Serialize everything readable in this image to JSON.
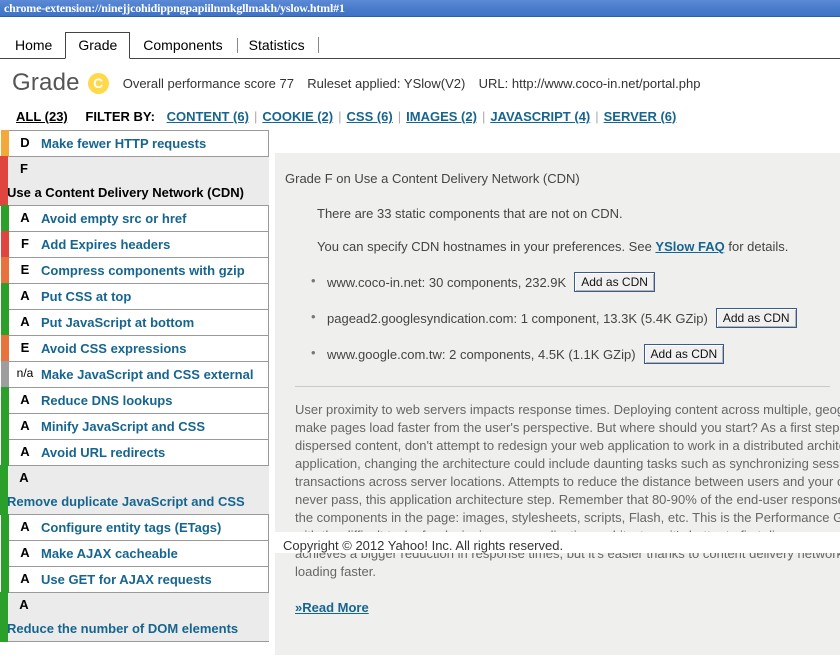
{
  "window": {
    "url": "chrome-extension://ninejjcohidippngpapiilnmkgllmakh/yslow.html#1"
  },
  "tabs": [
    {
      "label": "Home",
      "active": false
    },
    {
      "label": "Grade",
      "active": true
    },
    {
      "label": "Components",
      "active": false
    },
    {
      "label": "Statistics",
      "active": false
    }
  ],
  "header": {
    "grade_word": "Grade",
    "grade_letter": "C",
    "grade_color": "#ffd94a",
    "score_text": "Overall performance score 77",
    "ruleset_text": "Ruleset applied: YSlow(V2)",
    "url_text": "URL: http://www.coco-in.net/portal.php"
  },
  "filters": {
    "all_label": "ALL (23)",
    "filter_by_label": "FILTER BY:",
    "items": [
      {
        "label": "CONTENT (6)"
      },
      {
        "label": "COOKIE (2)"
      },
      {
        "label": "CSS (6)"
      },
      {
        "label": "IMAGES (2)"
      },
      {
        "label": "JAVASCRIPT (4)"
      },
      {
        "label": "SERVER (6)"
      }
    ]
  },
  "rules": [
    {
      "score": "D",
      "label": "Make fewer HTTP requests",
      "color": "#f2a83b",
      "selected": false,
      "wrapped": false
    },
    {
      "score": "F",
      "label": "Use a Content Delivery Network (CDN)",
      "color": "#e0443e",
      "selected": true,
      "wrapped": true
    },
    {
      "score": "A",
      "label": "Avoid empty src or href",
      "color": "#2aa02a",
      "selected": false,
      "wrapped": false
    },
    {
      "score": "F",
      "label": "Add Expires headers",
      "color": "#e0443e",
      "selected": false,
      "wrapped": false
    },
    {
      "score": "E",
      "label": "Compress components with gzip",
      "color": "#e8713c",
      "selected": false,
      "wrapped": false
    },
    {
      "score": "A",
      "label": "Put CSS at top",
      "color": "#2aa02a",
      "selected": false,
      "wrapped": false
    },
    {
      "score": "A",
      "label": "Put JavaScript at bottom",
      "color": "#2aa02a",
      "selected": false,
      "wrapped": false
    },
    {
      "score": "E",
      "label": "Avoid CSS expressions",
      "color": "#e8713c",
      "selected": false,
      "wrapped": false
    },
    {
      "score": "n/a",
      "label": "Make JavaScript and CSS external",
      "color": "#9e9e9e",
      "selected": false,
      "wrapped": false
    },
    {
      "score": "A",
      "label": "Reduce DNS lookups",
      "color": "#2aa02a",
      "selected": false,
      "wrapped": false
    },
    {
      "score": "A",
      "label": "Minify JavaScript and CSS",
      "color": "#2aa02a",
      "selected": false,
      "wrapped": false
    },
    {
      "score": "A",
      "label": "Avoid URL redirects",
      "color": "#2aa02a",
      "selected": false,
      "wrapped": false
    },
    {
      "score": "A",
      "label": "Remove duplicate JavaScript and CSS",
      "color": "#2aa02a",
      "selected": false,
      "wrapped": true
    },
    {
      "score": "A",
      "label": "Configure entity tags (ETags)",
      "color": "#2aa02a",
      "selected": false,
      "wrapped": false
    },
    {
      "score": "A",
      "label": "Make AJAX cacheable",
      "color": "#2aa02a",
      "selected": false,
      "wrapped": false
    },
    {
      "score": "A",
      "label": "Use GET for AJAX requests",
      "color": "#2aa02a",
      "selected": false,
      "wrapped": false
    },
    {
      "score": "A",
      "label": "Reduce the number of DOM elements",
      "color": "#2aa02a",
      "selected": false,
      "wrapped": true
    }
  ],
  "detail": {
    "title": "Grade F on Use a Content Delivery Network (CDN)",
    "summary": "There are 33 static components that are not on CDN.",
    "hint_prefix": "You can specify CDN hostnames in your preferences. See ",
    "hint_link": "YSlow FAQ",
    "hint_suffix": " for details.",
    "hosts": [
      {
        "text": "www.coco-in.net: 30 components, 232.9K",
        "button": "Add as CDN"
      },
      {
        "text": "pagead2.googlesyndication.com: 1 component, 13.3K (5.4K GZip)",
        "button": "Add as CDN"
      },
      {
        "text": "www.google.com.tw: 2 components, 4.5K (1.1K GZip)",
        "button": "Add as CDN"
      }
    ],
    "description": "User proximity to web servers impacts response times. Deploying content across multiple, geographically dispersed servers will make pages load faster from the user's perspective. But where should you start? As a first step to implementing geographically dispersed content, don't attempt to redesign your web application to work in a distributed architecture. Depending on the application, changing the architecture could include daunting tasks such as synchronizing session state and replicating database transactions across server locations. Attempts to reduce the distance between users and your content could be delayed by, or never pass, this application architecture step. Remember that 80-90% of the end-user response time is spent downloading all the components in the page: images, stylesheets, scripts, Flash, etc. This is the Performance Golden Rule. Rather than starting with the difficult task of redesigning your application architecture, it's better to first disperse your static content. This not only achieves a bigger reduction in response times, but it's easier thanks to content delivery networks. Users perceive that pages are loading faster.",
    "read_more": "»Read More"
  },
  "footer": {
    "copyright": "Copyright © 2012 Yahoo! Inc. All rights reserved."
  }
}
